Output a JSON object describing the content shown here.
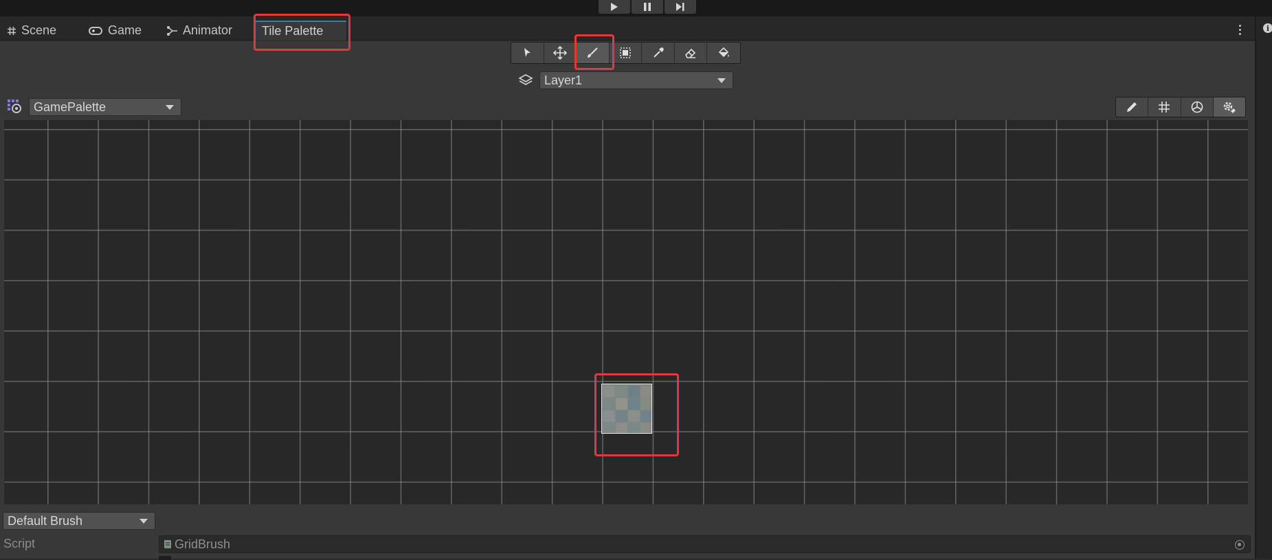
{
  "tabs": [
    {
      "label": "Scene",
      "icon": "grid-icon"
    },
    {
      "label": "Game",
      "icon": "gamepad-icon"
    },
    {
      "label": "Animator",
      "icon": "animator-icon"
    },
    {
      "label": "Tile Palette",
      "icon": "none",
      "active": true
    }
  ],
  "playbar": {
    "buttons": [
      "play-icon",
      "pause-icon",
      "step-icon"
    ]
  },
  "tools": [
    "select-icon",
    "move-icon",
    "paint-brush-icon",
    "box-fill-icon",
    "picker-icon",
    "eraser-icon",
    "fill-bucket-icon"
  ],
  "active_tool": "paint-brush-icon",
  "target_layer": {
    "value": "Layer1"
  },
  "palette": {
    "value": "GamePalette"
  },
  "palette_tools": [
    "edit-icon",
    "grid-toggle-icon",
    "gizmo-icon",
    "settings-icon"
  ],
  "brush": {
    "value": "Default Brush"
  },
  "script": {
    "label": "Script",
    "value": "GridBrush"
  },
  "colors": {
    "accent": "#3a79bb",
    "highlight": "#e23a3a",
    "background": "#383838",
    "grid_bg": "#282828"
  }
}
